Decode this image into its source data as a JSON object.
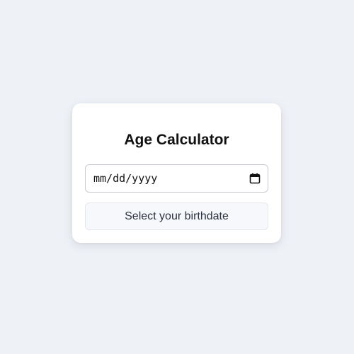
{
  "app": {
    "title": "Age Calculator"
  },
  "birthdate_input": {
    "placeholder": "mm/dd/yyyy",
    "value": "",
    "icon": "calendar-icon"
  },
  "result": {
    "text": "Select your birthdate"
  },
  "colors": {
    "page_background": "#eef2f7",
    "card_background": "#ffffff",
    "result_background": "#f6f8fb"
  }
}
